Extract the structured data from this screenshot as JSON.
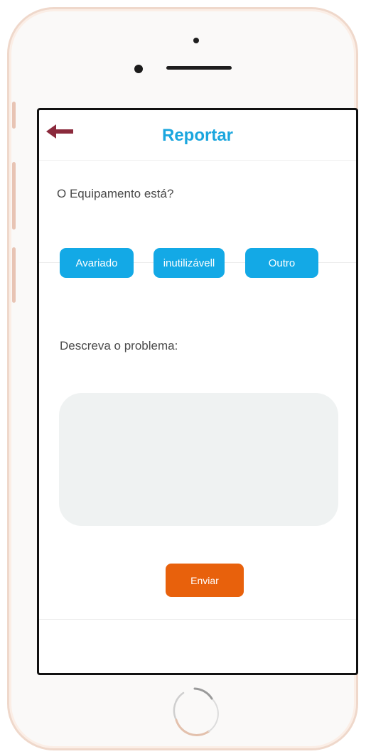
{
  "header": {
    "title": "Reportar"
  },
  "form": {
    "question": "O Equipamento está?",
    "options": [
      "Avariado",
      "inutilizávell",
      "Outro"
    ],
    "describe_label": "Descreva o problema:",
    "textarea_value": "",
    "submit_label": "Enviar"
  },
  "icons": {
    "back": "arrow-left-icon",
    "home": "home-button"
  },
  "colors": {
    "title": "#1aa6de",
    "option_button": "#13a9e6",
    "submit_button": "#e8610c",
    "back_arrow": "#8b2a3c",
    "textarea_bg": "#eff2f2"
  }
}
